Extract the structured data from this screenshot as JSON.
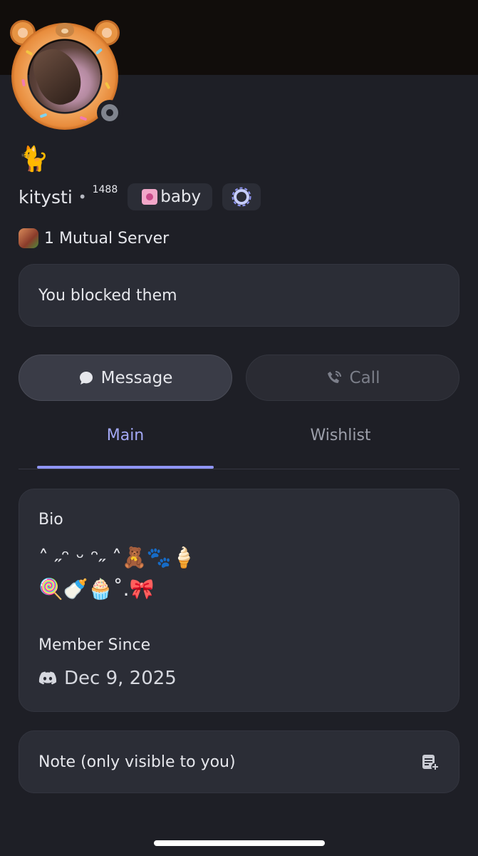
{
  "profile": {
    "pronoun_emoji": "🐈",
    "username": "kitysti",
    "separator": "•",
    "tag": "1488",
    "badge_label": "baby",
    "status": "offline"
  },
  "mutual": {
    "text": "1 Mutual Server"
  },
  "blocked_notice": "You blocked them",
  "actions": {
    "message_label": "Message",
    "call_label": "Call"
  },
  "tabs": [
    {
      "label": "Main",
      "active": true
    },
    {
      "label": "Wishlist",
      "active": false
    }
  ],
  "bio": {
    "heading": "Bio",
    "line1": "˄ ˶ᵔ ᵕ ᵔ˶ ˄🧸🐾🍦",
    "line2": "🍭🍼🧁˚.🎀"
  },
  "member_since": {
    "heading": "Member Since",
    "date": "Dec 9, 2025"
  },
  "note": {
    "label": "Note (only visible to you)"
  },
  "colors": {
    "accent": "#a3a8f5",
    "background": "#1e1f26",
    "card": "#2b2d36"
  }
}
